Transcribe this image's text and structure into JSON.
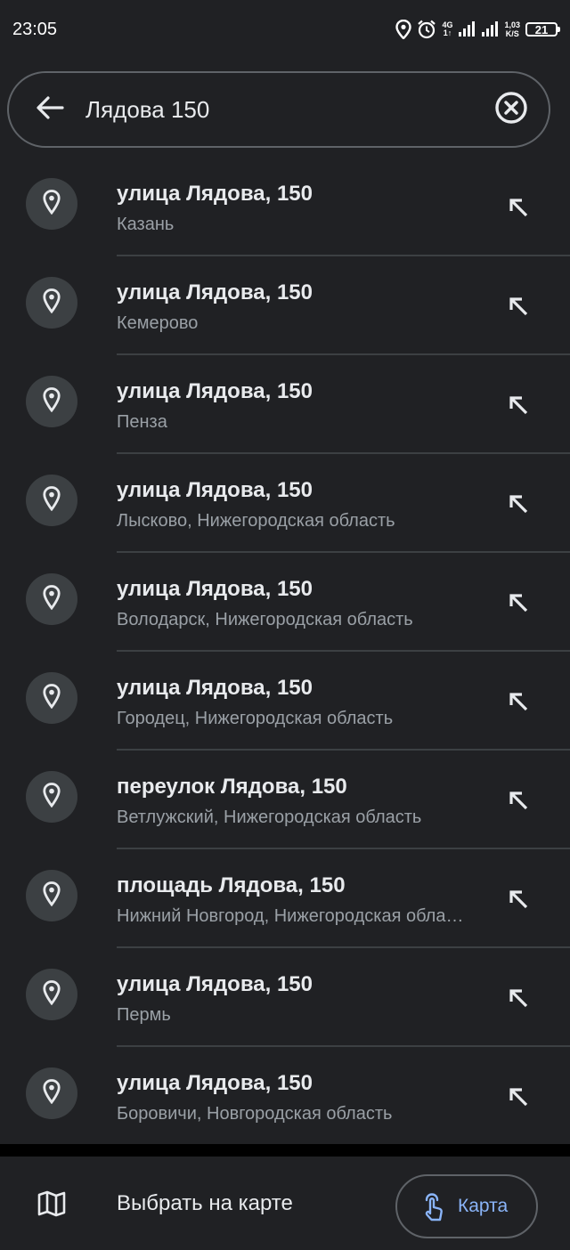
{
  "status_bar": {
    "time": "23:05",
    "network_type": "4G",
    "network_sub": "1↑",
    "speed_value": "1,03",
    "speed_unit": "K/S",
    "battery": "21"
  },
  "search": {
    "query": "Лядова 150",
    "back_icon": "arrow-left-icon",
    "clear_icon": "clear-circle-icon"
  },
  "results": [
    {
      "title": "улица Лядова, 150",
      "subtitle": "Казань"
    },
    {
      "title": "улица Лядова, 150",
      "subtitle": "Кемерово"
    },
    {
      "title": "улица Лядова, 150",
      "subtitle": "Пенза"
    },
    {
      "title": "улица Лядова, 150",
      "subtitle": "Лысково, Нижегородская область"
    },
    {
      "title": "улица Лядова, 150",
      "subtitle": "Володарск, Нижегородская область"
    },
    {
      "title": "улица Лядова, 150",
      "subtitle": "Городец, Нижегородская область"
    },
    {
      "title": "переулок Лядова, 150",
      "subtitle": "Ветлужский, Нижегородская область"
    },
    {
      "title": "площадь Лядова, 150",
      "subtitle": "Нижний Новгород, Нижегородская область"
    },
    {
      "title": "улица Лядова, 150",
      "subtitle": "Пермь"
    },
    {
      "title": "улица Лядова, 150",
      "subtitle": "Боровичи, Новгородская область"
    }
  ],
  "bottom": {
    "choose_on_map_label": "Выбрать на карте",
    "map_button_label": "Карта"
  },
  "colors": {
    "background": "#202124",
    "text_primary": "#e8eaed",
    "text_secondary": "#9aa0a6",
    "accent": "#8ab4f8"
  }
}
